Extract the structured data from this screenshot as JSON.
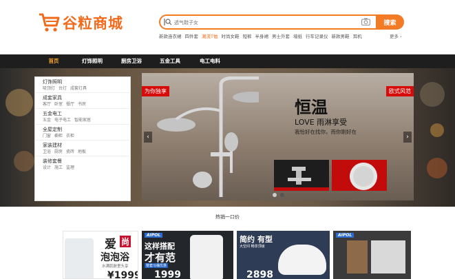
{
  "brand": {
    "name": "谷粒商城",
    "color": "#f26a1b"
  },
  "search": {
    "placeholder": "透气鞋子女",
    "button": "搜索"
  },
  "hot_words": [
    "新款连衣裙",
    "四件套",
    "潮流T恤",
    "时尚女鞋",
    "短裤",
    "半身裙",
    "男士外套",
    "墙纸",
    "行车记录仪",
    "新款男鞋",
    "耳机"
  ],
  "hot_more": "更多 ›",
  "nav": [
    "首页",
    "灯饰照明",
    "厨房卫浴",
    "五金工具",
    "电工电料"
  ],
  "categories": [
    {
      "title": "灯饰照明",
      "subs": [
        "吸顶灯",
        "台灯",
        "成套灯具"
      ]
    },
    {
      "title": "成套家具",
      "subs": [
        "客厅",
        "卧室",
        "餐厅",
        "书房"
      ]
    },
    {
      "title": "五金电工",
      "subs": [
        "五金",
        "电子电工",
        "智能家居"
      ]
    },
    {
      "title": "全屋定制",
      "subs": [
        "门窗",
        "橱柜",
        "衣柜"
      ]
    },
    {
      "title": "家装建材",
      "subs": [
        "卫浴",
        "厨房",
        "瓷砖",
        "地板"
      ]
    },
    {
      "title": "装修套餐",
      "subs": [
        "设计",
        "施工",
        "监理"
      ]
    }
  ],
  "hero": {
    "tag_left": "为你独享",
    "tag_right": "欧式风范",
    "title": "恒温",
    "subtitle": "LOVE 雨淋享受",
    "slogan": "我恰好在找你，而你刚好在",
    "prev": "‹",
    "next": "›"
  },
  "section_title": "热销一口价",
  "products": [
    {
      "line1": "爱",
      "line1b": "尚",
      "line2": "泡泡浴",
      "line3": "水满肌肤里头享",
      "price": "¥1999"
    },
    {
      "brand": "AIPOL",
      "line1": "这样搭配",
      "line2": "才有范",
      "line3": "整套马桶优惠",
      "price": "1999"
    },
    {
      "line1": "简约",
      "line1b": "有型",
      "line2": "大空间 畅享顶级",
      "price": "2898"
    },
    {
      "brand": "AIPOL"
    }
  ]
}
